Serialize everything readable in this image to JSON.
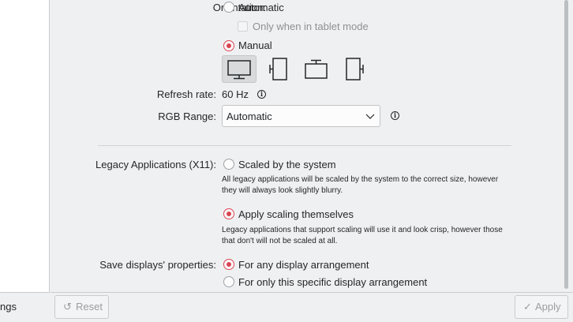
{
  "sidebar": {
    "bottom_label": "ngs"
  },
  "orientation": {
    "label": "Orientation:",
    "automatic": "Automatic",
    "tablet_mode": "Only when in tablet mode",
    "manual": "Manual"
  },
  "refresh_rate": {
    "label": "Refresh rate:",
    "value": "60 Hz"
  },
  "rgb_range": {
    "label": "RGB Range:",
    "value": "Automatic"
  },
  "legacy": {
    "label": "Legacy Applications (X11):",
    "scaled_by_system": "Scaled by the system",
    "scaled_by_system_desc": "All legacy applications will be scaled by the system to the correct size, however they will always look slightly blurry.",
    "apply_scaling": "Apply scaling themselves",
    "apply_scaling_desc": "Legacy applications that support scaling will use it and look crisp, however those that don't will not be scaled at all."
  },
  "save_displays": {
    "label": "Save displays' properties:",
    "any_arrangement": "For any display arrangement",
    "specific_arrangement": "For only this specific display arrangement"
  },
  "buttons": {
    "reset": "Reset",
    "apply": "Apply"
  },
  "icons": {
    "info": "i",
    "reset": "↺",
    "apply": "✓"
  },
  "colors": {
    "accent": "#da4453",
    "text": "#232629",
    "disabled": "#8d9194"
  }
}
